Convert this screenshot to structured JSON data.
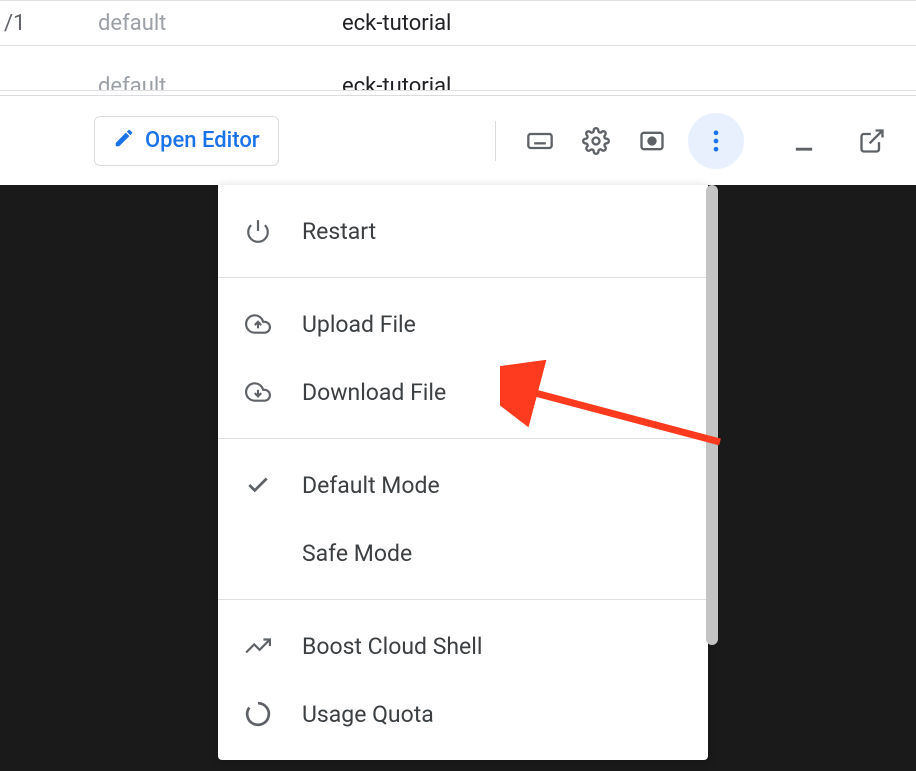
{
  "table": {
    "rows": [
      {
        "col1": "/1",
        "col2": "default",
        "col3": "eck-tutorial"
      },
      {
        "col1": "",
        "col2": "default",
        "col3": "eck-tutorial"
      }
    ]
  },
  "toolbar": {
    "open_editor_label": "Open Editor"
  },
  "menu": {
    "restart": "Restart",
    "upload": "Upload File",
    "download": "Download File",
    "default_mode": "Default Mode",
    "safe_mode": "Safe Mode",
    "boost": "Boost Cloud Shell",
    "usage_quota": "Usage Quota"
  }
}
